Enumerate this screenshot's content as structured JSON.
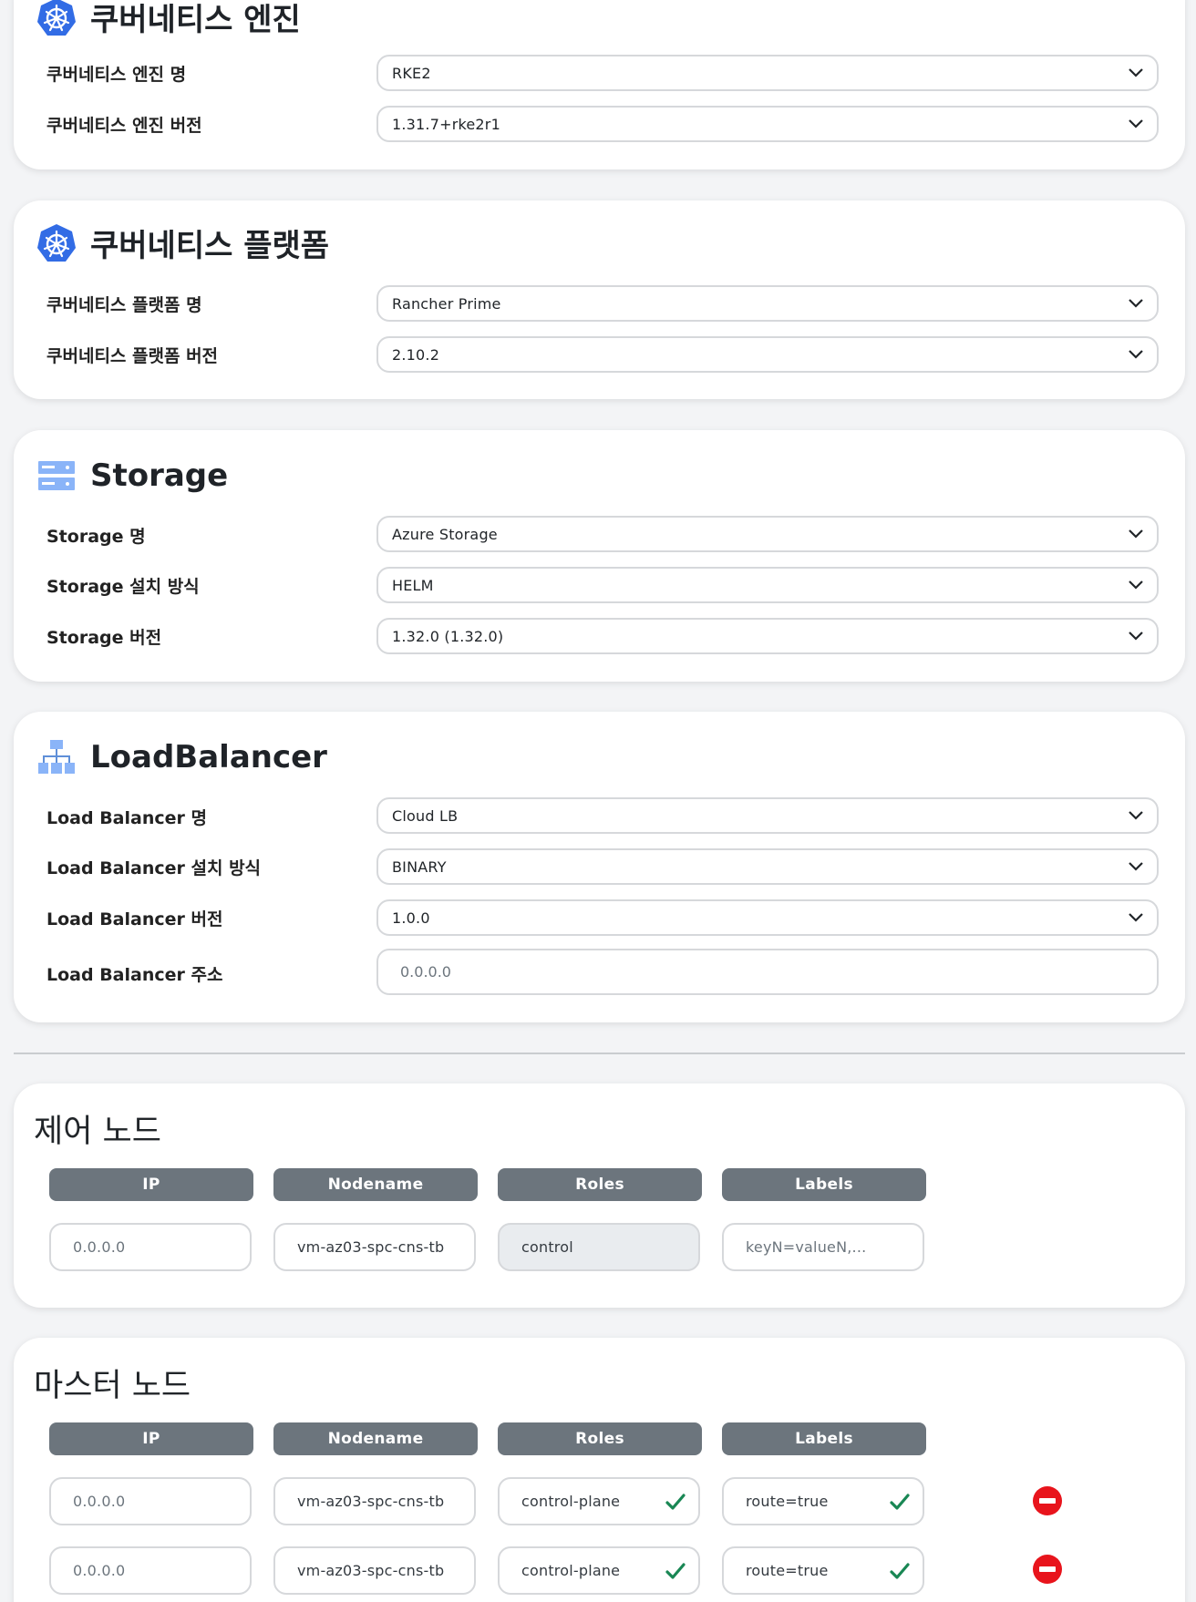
{
  "colors": {
    "accent_blue": "#326ce5",
    "storage_blue": "#8ab4f8",
    "header_gray": "#6c757d",
    "remove_red": "#e8141c",
    "check_green": "#198754"
  },
  "kube_engine": {
    "icon": "kubernetes-icon",
    "title": "쿠버네티스 엔진",
    "fields": [
      {
        "label": "쿠버네티스 엔진 명",
        "value": "RKE2"
      },
      {
        "label": "쿠버네티스 엔진 버전",
        "value": "1.31.7+rke2r1"
      }
    ]
  },
  "kube_platform": {
    "icon": "kubernetes-icon",
    "title": "쿠버네티스 플랫폼",
    "fields": [
      {
        "label": "쿠버네티스 플랫폼 명",
        "value": "Rancher Prime"
      },
      {
        "label": "쿠버네티스 플랫폼 버전",
        "value": "2.10.2"
      }
    ]
  },
  "storage": {
    "icon": "storage-server-icon",
    "title": "Storage",
    "fields": [
      {
        "label": "Storage 명",
        "value": "Azure Storage"
      },
      {
        "label": "Storage 설치 방식",
        "value": "HELM"
      },
      {
        "label": "Storage 버전",
        "value": "1.32.0 (1.32.0)"
      }
    ]
  },
  "load_balancer": {
    "icon": "network-hierarchy-icon",
    "title": "LoadBalancer",
    "fields": [
      {
        "label": "Load Balancer 명",
        "value": "Cloud LB"
      },
      {
        "label": "Load Balancer 설치 방식",
        "value": "BINARY"
      },
      {
        "label": "Load Balancer 버전",
        "value": "1.0.0"
      }
    ],
    "address": {
      "label": "Load Balancer 주소",
      "placeholder": "0.0.0.0"
    }
  },
  "control_nodes": {
    "title": "제어 노드",
    "columns": [
      "IP",
      "Nodename",
      "Roles",
      "Labels"
    ],
    "rows": [
      {
        "ip": "0.0.0.0",
        "nodename": "vm-az03-spc-cns-tb",
        "roles": "control",
        "labels": "keyN=valueN,..."
      }
    ]
  },
  "master_nodes": {
    "title": "마스터 노드",
    "columns": [
      "IP",
      "Nodename",
      "Roles",
      "Labels"
    ],
    "rows": [
      {
        "ip": "0.0.0.0",
        "nodename": "vm-az03-spc-cns-tb",
        "roles": "control-plane",
        "labels": "route=true"
      },
      {
        "ip": "0.0.0.0",
        "nodename": "vm-az03-spc-cns-tb",
        "roles": "control-plane",
        "labels": "route=true"
      }
    ]
  }
}
